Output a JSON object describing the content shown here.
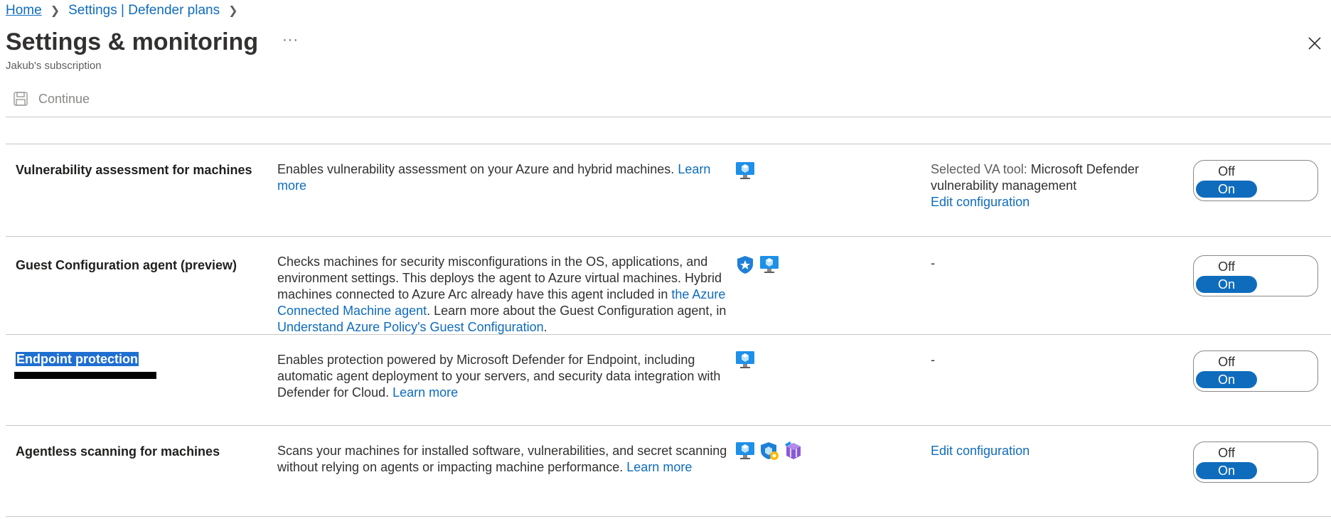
{
  "breadcrumb": {
    "home": "Home",
    "settings": "Settings | Defender plans"
  },
  "header": {
    "title": "Settings & monitoring",
    "more": "···",
    "subtitle": "Jakub's subscription"
  },
  "toolbar": {
    "continue_label": "Continue"
  },
  "rows": [
    {
      "name": "Vulnerability assessment for machines",
      "desc": "Enables vulnerability assessment on your Azure and hybrid machines.",
      "desc_link": "Learn more",
      "icons": [
        "virtual-machine-icon"
      ],
      "config_label": "Selected VA tool:",
      "config_value": "Microsoft Defender vulnerability management",
      "config_link": "Edit configuration",
      "toggle_off": "Off",
      "toggle_on": "On"
    },
    {
      "name": "Guest Configuration agent (preview)",
      "desc_1": "Checks machines for security misconfigurations in the OS, applications, and environment settings. This deploys the agent to Azure virtual machines. Hybrid machines connected to Azure Arc already have this agent included in",
      "desc_link_1": "the Azure Connected Machine agent",
      "desc_2": ". Learn more about the Guest Configuration agent, in",
      "desc_link_2": "Understand Azure Policy's Guest Configuration",
      "desc_3": ".",
      "icons": [
        "policy-shield-icon",
        "virtual-machine-icon"
      ],
      "config": "-",
      "toggle_off": "Off",
      "toggle_on": "On"
    },
    {
      "name": "Endpoint protection",
      "desc": "Enables protection powered by Microsoft Defender for Endpoint, including automatic agent deployment to your servers, and security data integration with Defender for Cloud.",
      "desc_link": "Learn more",
      "icons": [
        "virtual-machine-icon"
      ],
      "config": "-",
      "toggle_off": "Off",
      "toggle_on": "On"
    },
    {
      "name": "Agentless scanning for machines",
      "desc": "Scans your machines for installed software, vulnerabilities, and secret scanning without relying on agents or impacting machine performance.",
      "desc_link": "Learn more",
      "icons": [
        "virtual-machine-icon",
        "scale-set-icon",
        "container-registry-icon"
      ],
      "config_link": "Edit configuration",
      "toggle_off": "Off",
      "toggle_on": "On"
    }
  ],
  "colors": {
    "accent": "#0f6cbd",
    "selection": "#1f6fd1",
    "divider": "#c8c6c4"
  }
}
